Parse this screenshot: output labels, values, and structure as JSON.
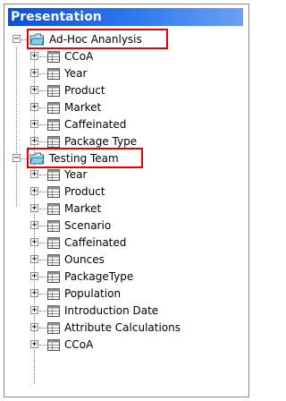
{
  "panel": {
    "title": "Presentation"
  },
  "tree": {
    "groups": [
      {
        "label": "Ad-Hoc Ananlysis",
        "expanded": true,
        "highlighted": true,
        "items": [
          "CCoA",
          "Year",
          "Product",
          "Market",
          "Caffeinated",
          "Package Type"
        ]
      },
      {
        "label": "Testing Team",
        "expanded": true,
        "highlighted": true,
        "items": [
          "Year",
          "Product",
          "Market",
          "Scenario",
          "Caffeinated",
          "Ounces",
          "PackageType",
          "Population",
          "Introduction Date",
          "Attribute Calculations",
          "CCoA"
        ]
      }
    ]
  },
  "icons": {
    "group": "folder-icon",
    "item": "table-icon",
    "expand": "plus",
    "collapse": "minus"
  },
  "colors": {
    "title_bar": "#2f79ee",
    "highlight": "#e60000",
    "folder": "#7fd0ee"
  }
}
